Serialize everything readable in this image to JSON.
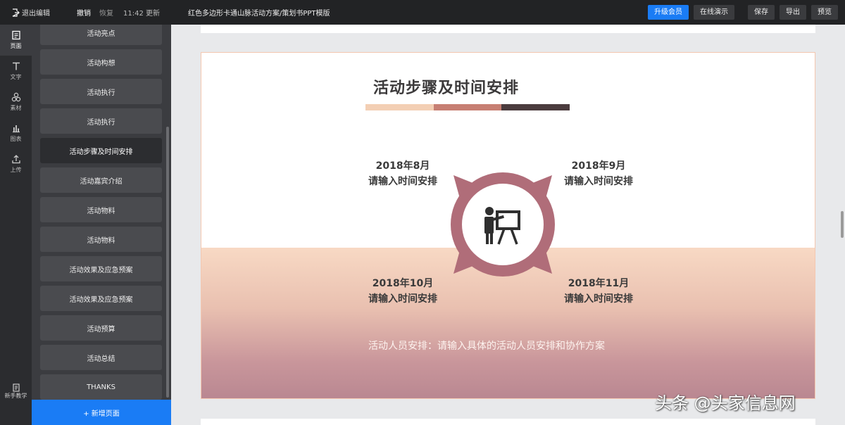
{
  "topbar": {
    "exit_label": "退出编辑",
    "undo_label": "撤销",
    "redo_label": "恢复",
    "save_time": "11:42 更新",
    "doc_title": "红色多边形卡通山脉活动方案/策划书PPT模版",
    "upgrade_label": "升级会员",
    "present_label": "在线演示",
    "save_label": "保存",
    "export_label": "导出",
    "preview_label": "预览"
  },
  "rail": {
    "items": [
      {
        "label": "页面",
        "icon": "page-icon"
      },
      {
        "label": "文字",
        "icon": "text-icon"
      },
      {
        "label": "素材",
        "icon": "shapes-icon"
      },
      {
        "label": "图表",
        "icon": "chart-icon"
      },
      {
        "label": "上传",
        "icon": "upload-icon"
      }
    ],
    "tutorial_label": "新手教学"
  },
  "pages": [
    "活动亮点",
    "活动构想",
    "活动执行",
    "活动执行",
    "活动步骤及时间安排",
    "活动嘉宾介绍",
    "活动物料",
    "活动物料",
    "活动效果及应急预案",
    "活动效果及应急预案",
    "活动预算",
    "活动总结",
    "THANKS"
  ],
  "active_page_index": 4,
  "add_page_label": "+ 新增页面",
  "slide": {
    "title": "活动步骤及时间安排",
    "bar_colors": [
      "#f3cfb4",
      "#c77f73",
      "#4b3c3e"
    ],
    "hub_color": "#b06d79",
    "quadrants": [
      {
        "date": "2018年8月",
        "desc": "请输入时间安排"
      },
      {
        "date": "2018年9月",
        "desc": "请输入时间安排"
      },
      {
        "date": "2018年10月",
        "desc": "请输入时间安排"
      },
      {
        "date": "2018年11月",
        "desc": "请输入时间安排"
      }
    ],
    "staff_note": "活动人员安排：请输入具体的活动人员安排和协作方案"
  },
  "watermark": "头条 @头家信息网"
}
